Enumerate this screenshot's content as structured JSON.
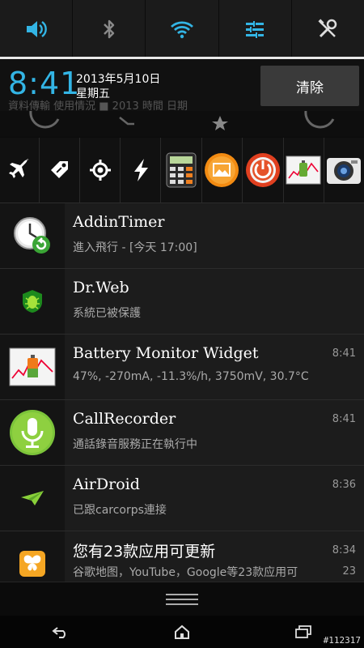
{
  "quick_toggles": [
    {
      "icon": "volume-icon",
      "active": true
    },
    {
      "icon": "bluetooth-icon",
      "active": false
    },
    {
      "icon": "wifi-icon",
      "active": true
    },
    {
      "icon": "sync-settings-icon",
      "active": true
    },
    {
      "icon": "tools-icon",
      "active": false
    }
  ],
  "header": {
    "time": "8:41",
    "date": "2013年5月10日",
    "weekday": "星期五",
    "clear_label": "清除",
    "ghost_text": "資料傳輸 使用情況 ■ 2013 時間 日期"
  },
  "shortcut_icons": [
    "airplane-icon",
    "tag-icon",
    "gps-icon",
    "flash-icon",
    "calculator-icon",
    "gallery-icon",
    "power-icon",
    "chart-icon",
    "camera-icon"
  ],
  "notifications": [
    {
      "icon": "timer-clock-icon",
      "title": "AddinTimer",
      "subtitle": "進入飛行 - [今天 17:00]",
      "time": "",
      "count": ""
    },
    {
      "icon": "drweb-spider-icon",
      "title": "Dr.Web",
      "subtitle": "系統已被保護",
      "time": "",
      "count": ""
    },
    {
      "icon": "battery-monitor-icon",
      "title": "Battery Monitor Widget",
      "subtitle": "47%, -270mA, -11.3%/h, 3750mV, 30.7°C",
      "time": "8:41",
      "count": ""
    },
    {
      "icon": "microphone-icon",
      "title": "CallRecorder",
      "subtitle": "通話錄音服務正在執行中",
      "time": "8:41",
      "count": ""
    },
    {
      "icon": "paper-plane-icon",
      "title": "AirDroid",
      "subtitle": "已跟carcorps連接",
      "time": "8:36",
      "count": ""
    },
    {
      "icon": "butterfly-icon",
      "title": "您有23款应用可更新",
      "subtitle": "谷歌地图，YouTube，Google等23款应用可",
      "time": "8:34",
      "count": "23"
    }
  ],
  "watermark": "#112317",
  "colors": {
    "accent": "#33b5e5",
    "background": "#0b0b0b",
    "row": "#1c1c1c"
  }
}
